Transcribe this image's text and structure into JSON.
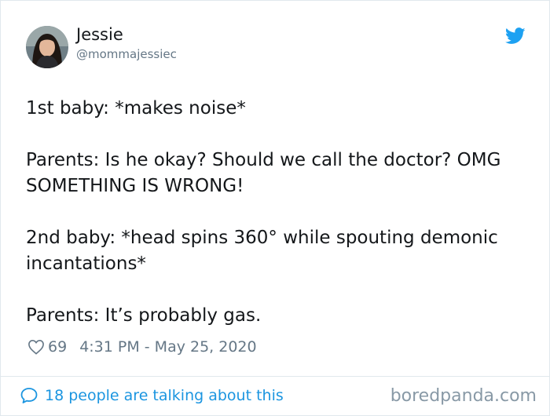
{
  "author": {
    "display_name": "Jessie",
    "handle": "@mommajessiec"
  },
  "tweet": {
    "lines": [
      "1st baby: *makes noise*",
      "Parents: Is he okay? Should we call the doctor? OMG",
      "SOMETHING IS WRONG!",
      "2nd baby: *head spins 360° while spouting demonic",
      "incantations*",
      "Parents: It’s probably gas."
    ]
  },
  "meta": {
    "likes": "69",
    "timestamp": "4:31 PM - May 25, 2020"
  },
  "footer": {
    "conversation_link": "18 people are talking about this",
    "watermark": "boredpanda.com"
  },
  "colors": {
    "twitter_blue": "#1da1f2",
    "link_blue": "#1b95e0",
    "muted_gray": "#657786"
  },
  "icons": {
    "brand": "twitter-bird-icon",
    "like": "heart-icon",
    "reply": "speech-bubble-icon"
  }
}
